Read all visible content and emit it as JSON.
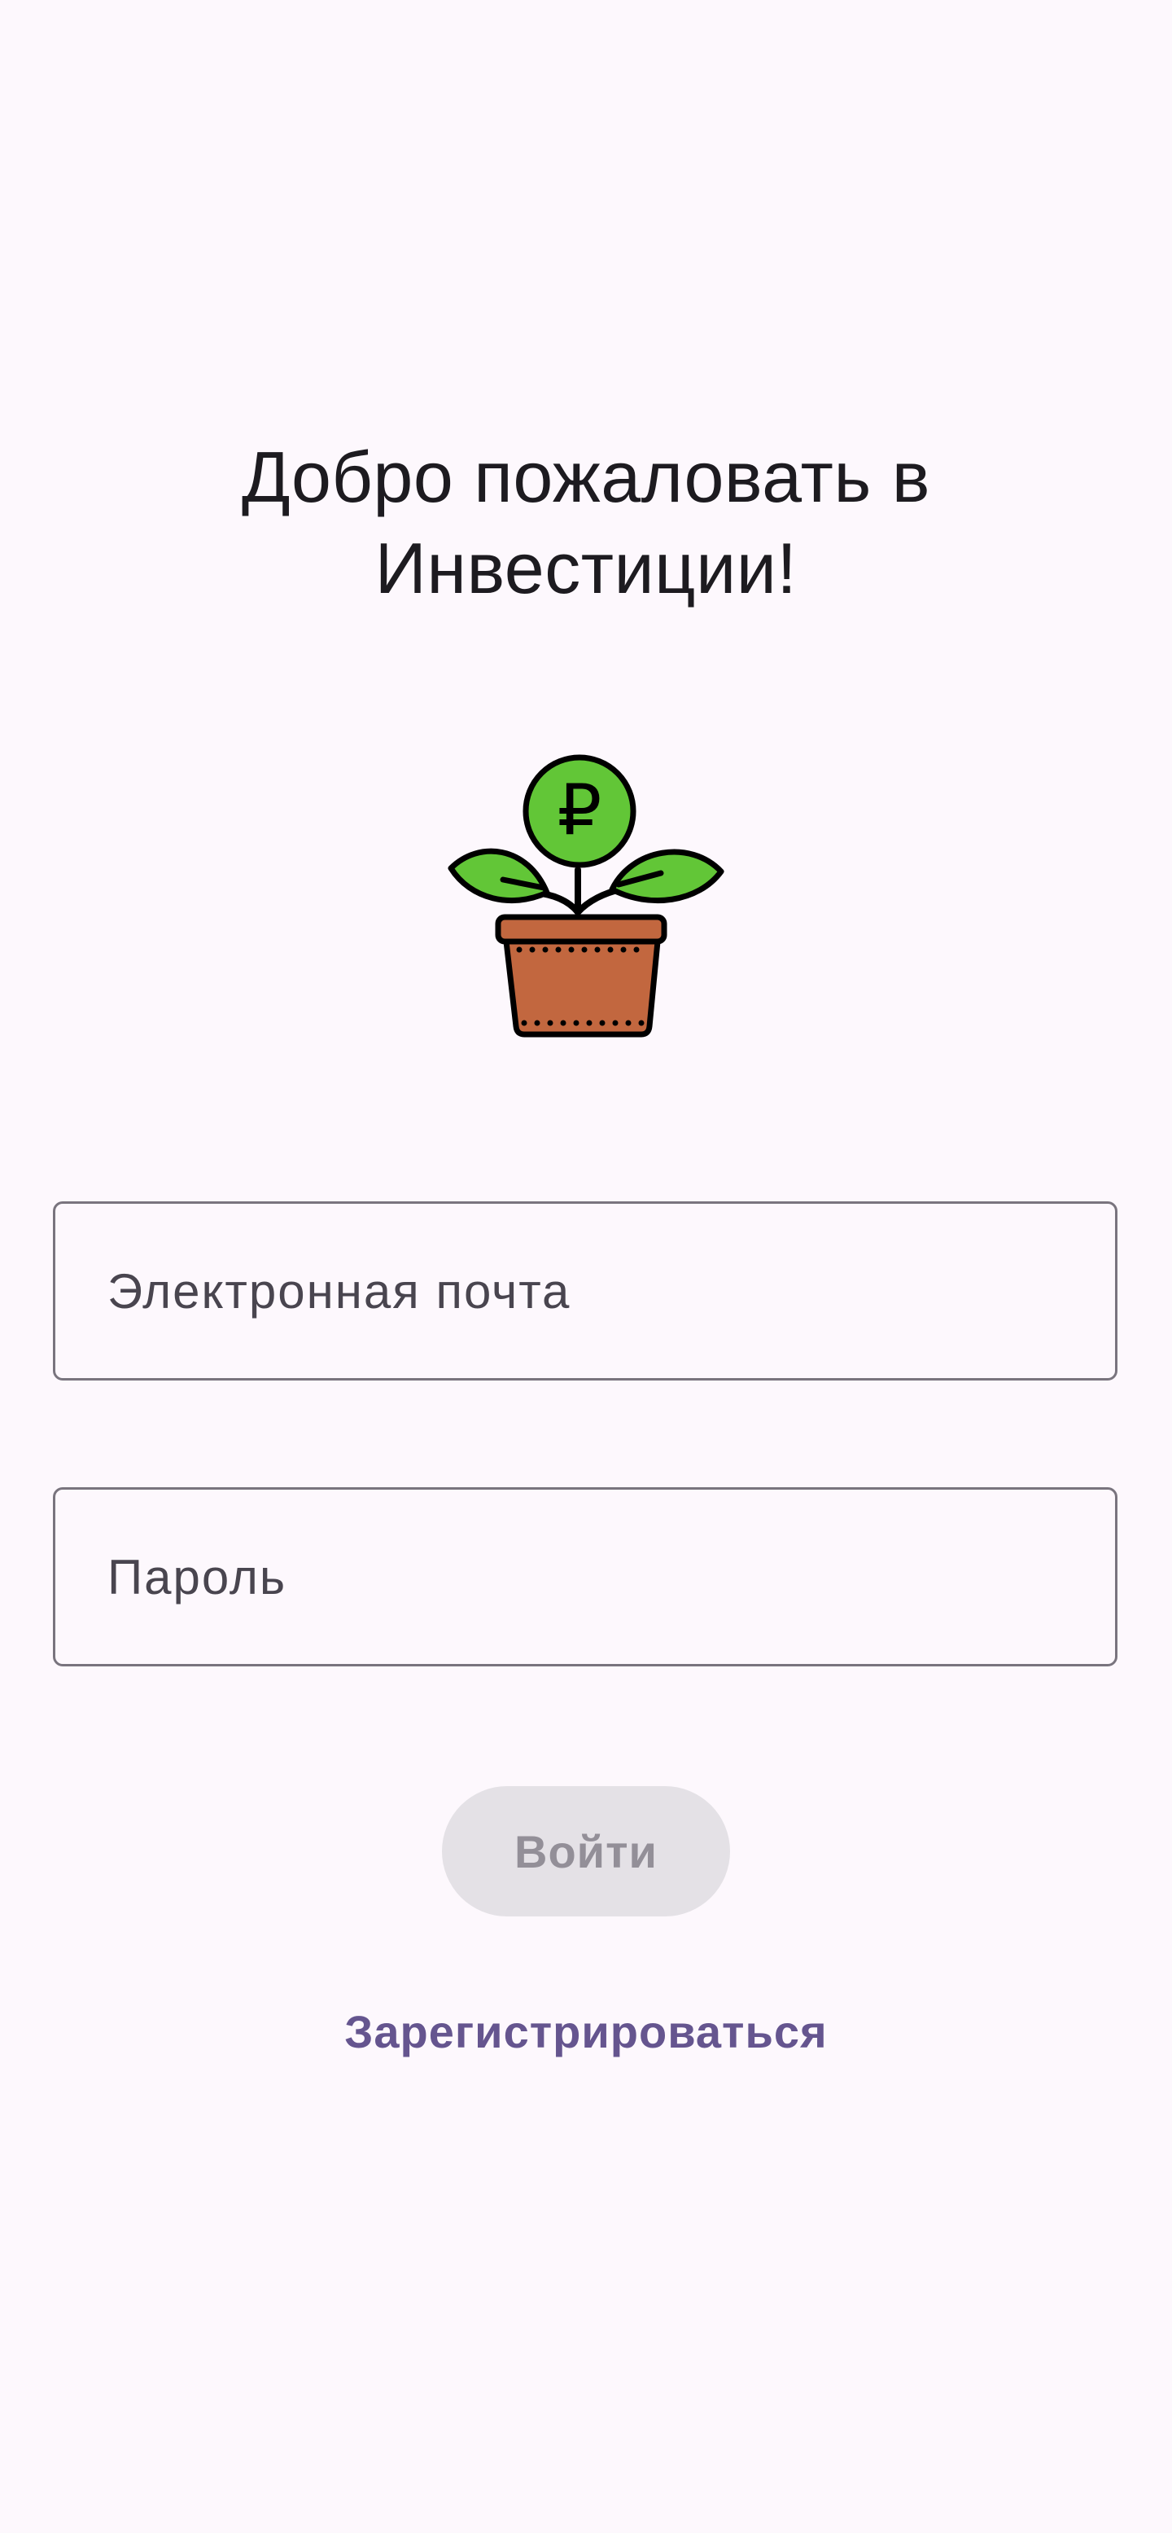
{
  "welcome": {
    "title_line1": "Добро пожаловать в",
    "title_line2": "Инвестиции!"
  },
  "illustration": {
    "icon": "money-plant-icon",
    "currency_symbol": "₽",
    "colors": {
      "leaf": "#62c637",
      "pot": "#c2673f",
      "outline": "#000000"
    }
  },
  "form": {
    "email": {
      "placeholder": "Электронная почта",
      "value": ""
    },
    "password": {
      "placeholder": "Пароль",
      "value": ""
    },
    "login_label": "Войти",
    "register_label": "Зарегистрироваться"
  },
  "colors": {
    "background": "#fdf8fd",
    "outline": "#79747e",
    "button_disabled_bg": "#e4e1e6",
    "button_disabled_text": "#938f98",
    "link": "#65558f"
  }
}
